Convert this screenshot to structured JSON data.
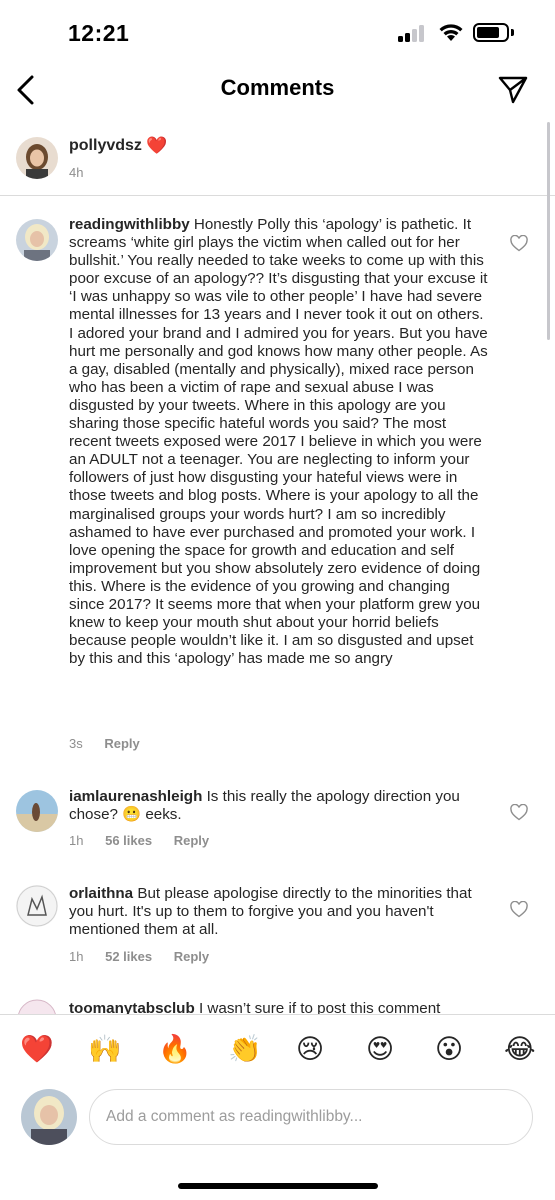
{
  "status": {
    "time": "12:21"
  },
  "nav": {
    "title": "Comments"
  },
  "caption": {
    "username": "pollyvdsz",
    "heart": "❤️",
    "time": "4h"
  },
  "comments": [
    {
      "username": "readingwithlibby",
      "text": " Honestly Polly this ‘apology’ is pathetic. It screams ‘white girl plays the victim when called out for her bullshit.’ You really needed to take weeks to come up with this poor excuse of an apology?? It’s disgusting that your excuse it ‘I was unhappy so was vile to other people’ I have had severe mental illnesses for 13 years and I never took it out on others. I adored your brand and I admired you for years. But you have hurt me personally and god knows how many other people. As a gay, disabled (mentally and physically), mixed race person who has been a victim of rape and sexual abuse I was disgusted by your tweets. Where in this apology are you sharing those specific hateful words you said? The most recent tweets exposed were 2017 I believe in which you were an ADULT not a teenager. You are neglecting to inform your followers of just how disgusting your hateful views were in those tweets and blog posts. Where is your apology to all the marginalised groups your words hurt? I am so incredibly ashamed to have ever purchased and promoted your work. I love opening the space for growth and education and self improvement but you show absolutely zero evidence of doing this. Where is the evidence of you growing and changing since 2017? It seems more that when your platform grew you knew to keep your mouth shut about your horrid beliefs because people wouldn’t like it. I am so disgusted and upset by this and this ‘apology’ has made me so angry",
      "time": "3s",
      "likes": "",
      "reply": "Reply"
    },
    {
      "username": "iamlaurenashleigh",
      "text": " Is this really the apology direction you chose? 😬 eeks.",
      "time": "1h",
      "likes": "56 likes",
      "reply": "Reply"
    },
    {
      "username": "orlaithna",
      "text": " But please apologise directly to the minorities that you hurt. It's up to them to forgive you and you haven't mentioned them at all.",
      "time": "1h",
      "likes": "52 likes",
      "reply": "Reply"
    },
    {
      "username": "toomanytabsclub",
      "text": " I wasn’t sure if to post this comment"
    }
  ],
  "emojis": [
    "❤️",
    "🙌",
    "🔥",
    "👏",
    "😢",
    "😍",
    "😮",
    "😂"
  ],
  "input": {
    "placeholder": "Add a comment as readingwithlibby..."
  },
  "colors": {
    "text": "#262626",
    "secondary": "#8e8e8e",
    "divider": "#dbdbdb",
    "heart": "#ed4956"
  }
}
